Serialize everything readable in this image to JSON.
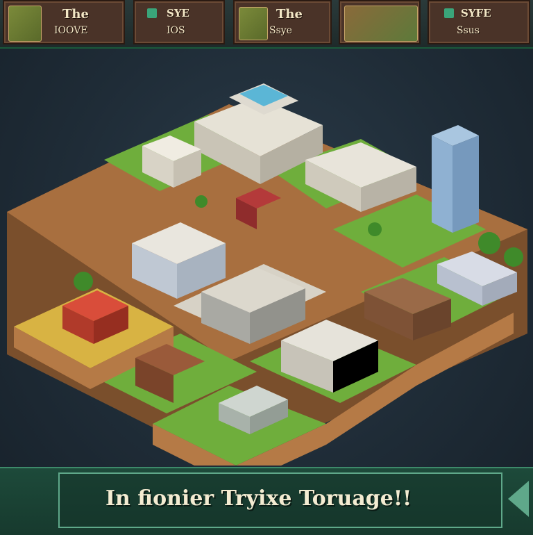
{
  "hud": {
    "cards": [
      {
        "line1": "The",
        "line2": "IOOVE"
      },
      {
        "line1": "SYE",
        "line2": "IOS"
      },
      {
        "line1": "The",
        "line2": "Ssye"
      },
      {
        "line1": "",
        "line2": ""
      },
      {
        "line1": "SYFE",
        "line2": "Ssus"
      }
    ]
  },
  "banner": {
    "message": "In fionier Tryixe Toruage!!"
  },
  "colors": {
    "grass": "#6fae3c",
    "wood": "#b57a46",
    "hud_bg": "#4a3328",
    "banner_bg": "#1d4a3a"
  }
}
